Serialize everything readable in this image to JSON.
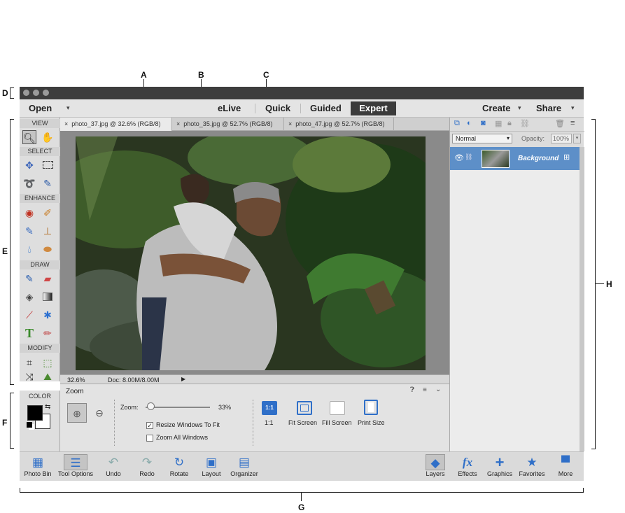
{
  "callouts": {
    "A": "A",
    "B": "B",
    "C": "C",
    "D": "D",
    "E": "E",
    "F": "F",
    "G": "G",
    "H": "H"
  },
  "menubar": {
    "open": "Open",
    "elive": "eLive",
    "quick": "Quick",
    "guided": "Guided",
    "expert": "Expert",
    "create": "Create",
    "share": "Share"
  },
  "toolbox": {
    "view": "VIEW",
    "select": "SELECT",
    "enhance": "ENHANCE",
    "draw": "DRAW",
    "modify": "MODIFY"
  },
  "color": {
    "title": "COLOR",
    "foreground": "#000000",
    "background": "#ffffff"
  },
  "tabs": [
    "photo_37.jpg @ 32.6% (RGB/8)",
    "photo_35.jpg @ 52.7% (RGB/8)",
    "photo_47.jpg @ 52.7% (RGB/8)"
  ],
  "tab_close": "×",
  "status": {
    "zoom": "32.6%",
    "doc": "Doc: 8.00M/8.00M"
  },
  "options": {
    "title": "Zoom",
    "zoom_label": "Zoom:",
    "zoom_value": "33%",
    "zoom_level": 0.33,
    "resize": "Resize Windows To Fit",
    "resize_checked": true,
    "zoom_all": "Zoom All Windows",
    "zoom_all_checked": false,
    "one_to_one_icon": "1:1",
    "one_to_one": "1:1",
    "fit_screen": "Fit Screen",
    "fill_screen": "Fill Screen",
    "print_size": "Print Size"
  },
  "layers": {
    "blend_mode": "Normal",
    "opacity_label": "Opacity:",
    "opacity_value": "100%",
    "layer_name": "Background"
  },
  "bottombar": {
    "photo_bin": "Photo Bin",
    "tool_options": "Tool Options",
    "undo": "Undo",
    "redo": "Redo",
    "rotate": "Rotate",
    "layout": "Layout",
    "organizer": "Organizer",
    "layers": "Layers",
    "effects": "Effects",
    "graphics": "Graphics",
    "favorites": "Favorites",
    "more": "More",
    "fx_icon": "fx"
  },
  "accent_colors": {
    "selected_layer": "#5d8fc8",
    "window_titlebar": "#3d3d3d",
    "expert_button": "#3b3b3b"
  }
}
